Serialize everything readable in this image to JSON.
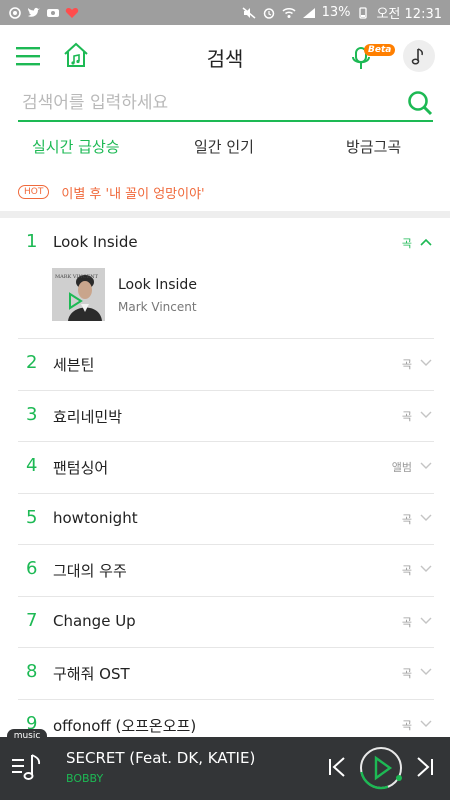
{
  "status_bar": {
    "battery": "13%",
    "time": "오전 12:31"
  },
  "header": {
    "title": "검색",
    "beta_badge": "Beta"
  },
  "search": {
    "placeholder": "검색어를 입력하세요",
    "value": ""
  },
  "tabs": [
    {
      "label": "실시간 급상승",
      "active": true
    },
    {
      "label": "일간 인기",
      "active": false
    },
    {
      "label": "방금그곡",
      "active": false
    }
  ],
  "hot": {
    "badge": "HOT",
    "text": "이별 후 '내 꼴이 엉망이야'"
  },
  "ranking": [
    {
      "rank": "1",
      "title": "Look Inside",
      "type": "곡",
      "expanded": true
    },
    {
      "rank": "2",
      "title": "세븐틴",
      "type": "곡"
    },
    {
      "rank": "3",
      "title": "효리네민박",
      "type": "곡"
    },
    {
      "rank": "4",
      "title": "팬텀싱어",
      "type": "앨범"
    },
    {
      "rank": "5",
      "title": "howtonight",
      "type": "곡"
    },
    {
      "rank": "6",
      "title": "그대의 우주",
      "type": "곡"
    },
    {
      "rank": "7",
      "title": "Change Up",
      "type": "곡"
    },
    {
      "rank": "8",
      "title": "구해줘 OST",
      "type": "곡"
    },
    {
      "rank": "9",
      "title": "offonoff (오프온오프)",
      "type": "곡"
    }
  ],
  "expanded_song": {
    "title": "Look Inside",
    "artist": "Mark Vincent",
    "album_art_text": "MARK VINCENT"
  },
  "player": {
    "tab_label": "music",
    "title": "SECRET (Feat. DK, KATIE)",
    "artist": "BOBBY"
  },
  "colors": {
    "accent": "#1db954",
    "hot": "#f06a3c",
    "beta": "#ff7f00",
    "player_bg": "#333537",
    "status_bar": "#9e9e9e"
  }
}
